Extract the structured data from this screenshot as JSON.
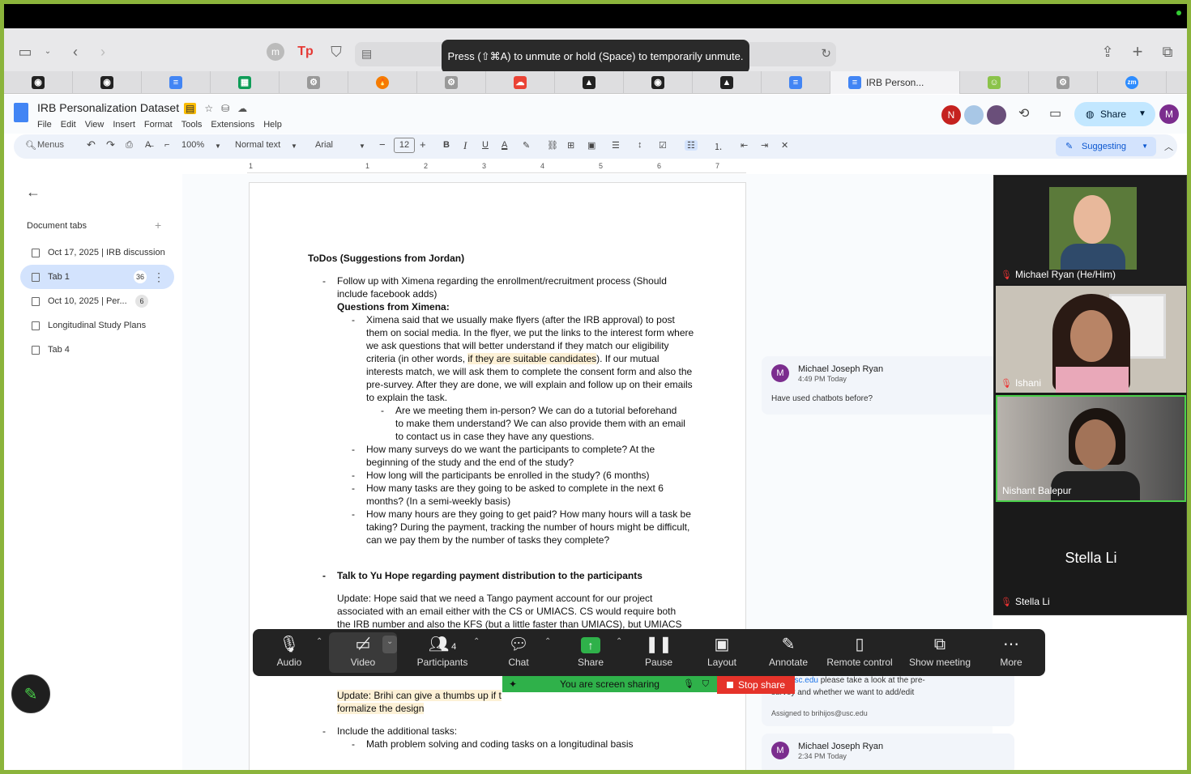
{
  "mute_toast": "Press (⇧⌘A) to unmute or hold (Space) to temporarily unmute.",
  "browser_tabs": [
    {
      "icon": "github-icon",
      "color": "#222",
      "glyph": "◉"
    },
    {
      "icon": "github-icon",
      "color": "#222",
      "glyph": "◉"
    },
    {
      "icon": "google-docs-icon",
      "color": "#4285f4",
      "glyph": "≡"
    },
    {
      "icon": "google-sheets-icon",
      "color": "#0f9d58",
      "glyph": "▦"
    },
    {
      "icon": "settings-icon",
      "color": "#999",
      "glyph": "⚙"
    },
    {
      "icon": "flame-icon",
      "color": "#f57c00",
      "glyph": "🔥"
    },
    {
      "icon": "settings-icon",
      "color": "#999",
      "glyph": "⚙"
    },
    {
      "icon": "google-cloud-icon",
      "color": "#ea4335",
      "glyph": "☁"
    },
    {
      "icon": "triangle-app-icon",
      "color": "#222",
      "glyph": "▲"
    },
    {
      "icon": "github-icon",
      "color": "#222",
      "glyph": "◉"
    },
    {
      "icon": "triangle-app-icon",
      "color": "#222",
      "glyph": "▲"
    },
    {
      "icon": "google-docs-icon",
      "color": "#4285f4",
      "glyph": "≡"
    }
  ],
  "active_tab_label": "IRB Person...",
  "browser_tabs_after": [
    {
      "icon": "emoji-icon",
      "color": "#8bc34a",
      "glyph": "☺"
    },
    {
      "icon": "settings-icon",
      "color": "#999",
      "glyph": "⚙"
    },
    {
      "icon": "zoom-icon",
      "color": "#2d8cff",
      "glyph": "zm"
    },
    {
      "icon": "github-icon",
      "color": "#222",
      "glyph": "◉"
    }
  ],
  "doc": {
    "title": "IRB Personalization Dataset",
    "menus": [
      "File",
      "Edit",
      "View",
      "Insert",
      "Format",
      "Tools",
      "Extensions",
      "Help"
    ],
    "share_label": "Share",
    "avatar_n": "N",
    "avatar_m": "M"
  },
  "toolbar": {
    "search": "Menus",
    "zoom": "100%",
    "style": "Normal text",
    "font": "Arial",
    "size": "12",
    "mode": "Suggesting"
  },
  "ruler": [
    "1",
    "1",
    "2",
    "3",
    "4",
    "5",
    "6",
    "7"
  ],
  "sidebar": {
    "heading": "Document tabs",
    "tabs": [
      {
        "label": "Oct 17, 2025 | IRB discussion"
      },
      {
        "label": "Tab 1",
        "badge": "36"
      },
      {
        "label": "Oct 10, 2025 | Per...",
        "badge": "6"
      },
      {
        "label": "Longitudinal Study Plans"
      },
      {
        "label": "Tab 4"
      }
    ]
  },
  "content": {
    "heading": "ToDos (Suggestions from Jordan)",
    "item1": "Follow up with Ximena regarding the enrollment/recruitment process (Should include facebook adds)",
    "questions_heading": "Questions from Ximena:",
    "q1_pre": "Ximena said that we usually make flyers (after the IRB approval) to post them on social media. In the flyer, we put the links to the interest form where we ask questions that will better understand if they match our eligibility criteria (in other words, ",
    "q1_hl": "if they are suitable candidates",
    "q1_post": "). If our mutual interests match, we will ask them to complete the consent form and also the pre-survey. After they are done, we will explain and follow up on their emails to explain the task.",
    "q1_sub": "Are we meeting them in-person? We can do a tutorial beforehand to make them understand? We can also provide them with an email to contact us in case they have any questions.",
    "q2": "How many surveys do we want the participants to complete? At the beginning of the study and the end of the study?",
    "q3": "How long will the participants be enrolled in the study? (6 months)",
    "q4": "How many tasks are they going to be asked to complete in the next 6 months? (In a semi-weekly basis)",
    "q5": "How many hours are they going to get paid? How many hours will a task be taking? During the payment, tracking the number of hours might be difficult, can we pay them by the number of tasks they complete?",
    "item2": "Talk to Yu Hope regarding payment distribution to the participants",
    "update1": "Update: Hope said that we need a Tango payment account for our project associated with an email either with the CS or UMIACS. CS would require both the IRB number and also the KFS (but a little faster than UMIACS), but UMIACS",
    "update2": "Update:  Brihi can give a thumbs up if t",
    "update2b": "formalize the design",
    "item3": "Include the additional tasks:",
    "item3_sub": "Math problem solving and coding tasks on a longitudinal basis"
  },
  "comments": [
    {
      "initial": "M",
      "name": "Michael Joseph Ryan",
      "time": "4:49 PM Today",
      "body": "Have used chatbots before?"
    },
    {
      "body_link": "jos@usc.edu",
      "body": " please take a look at the pre-",
      "body2": "survey and whether we want to add/edit",
      "assigned": "Assigned to brihijos@usc.edu"
    },
    {
      "initial": "M",
      "name": "Michael Joseph Ryan",
      "time": "2:34 PM Today"
    }
  ],
  "participants": [
    {
      "name": "Michael Ryan (He/Him)"
    },
    {
      "name": "Ishani"
    },
    {
      "name": "Nishant Balepur"
    },
    {
      "name": "Stella Li",
      "big": "Stella Li"
    }
  ],
  "zoom_bar": {
    "audio": "Audio",
    "video": "Video",
    "participants": "Participants",
    "participants_count": "4",
    "chat": "Chat",
    "share": "Share",
    "pause": "Pause",
    "layout": "Layout",
    "annotate": "Annotate",
    "remote": "Remote control",
    "show_meeting": "Show meeting",
    "more": "More"
  },
  "screen_sharing": "You are screen sharing",
  "stop_share": "Stop share"
}
